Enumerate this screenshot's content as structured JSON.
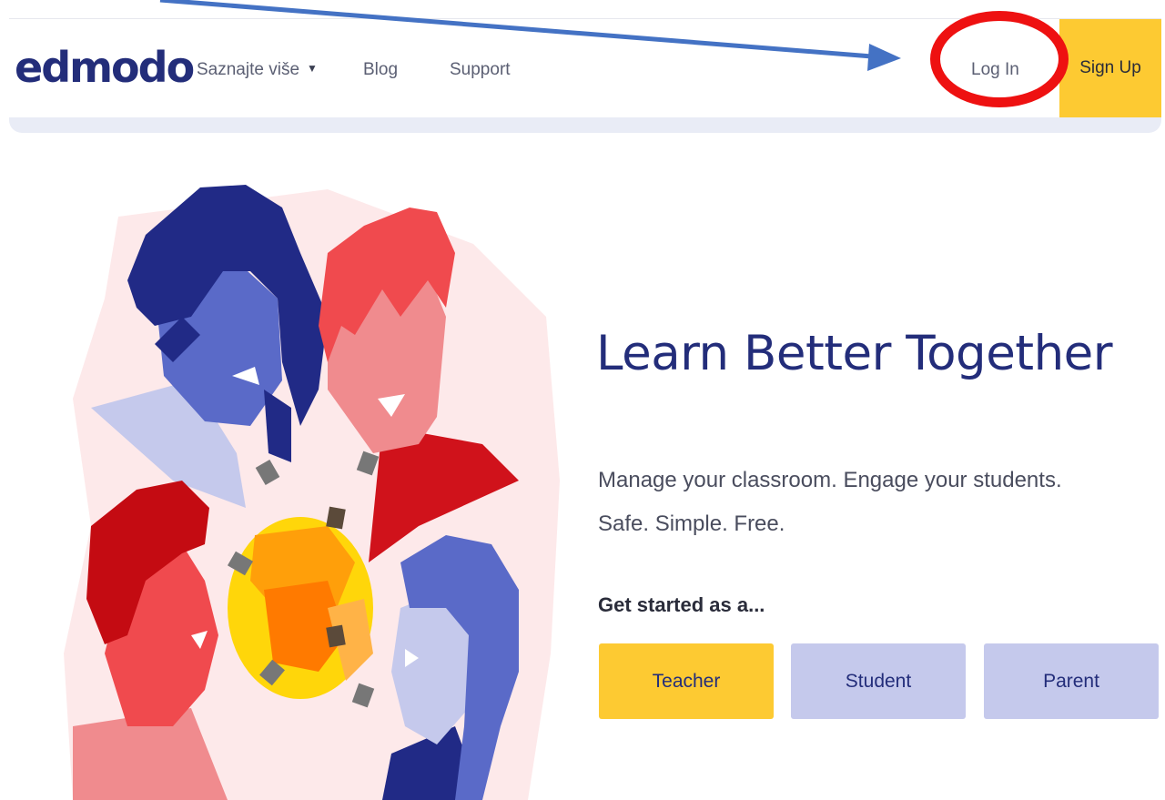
{
  "nav": {
    "logo": "edmodo",
    "learn_more": "Saznajte više",
    "blog": "Blog",
    "support": "Support",
    "login": "Log In",
    "signup": "Sign Up"
  },
  "hero": {
    "title": "Learn Better Together",
    "subtitle_line1": "Manage your classroom. Engage your students.",
    "subtitle_line2": "Safe. Simple. Free.",
    "get_started": "Get started as a...",
    "roles": {
      "teacher": "Teacher",
      "student": "Student",
      "parent": "Parent"
    }
  },
  "colors": {
    "brand_navy": "#232d7a",
    "accent_yellow": "#fdca32",
    "role_lavender": "#c5c9ec",
    "annotation_red": "#ee1111",
    "annotation_blue": "#4472c4"
  },
  "icons": {
    "dropdown": "caret-down-icon"
  }
}
